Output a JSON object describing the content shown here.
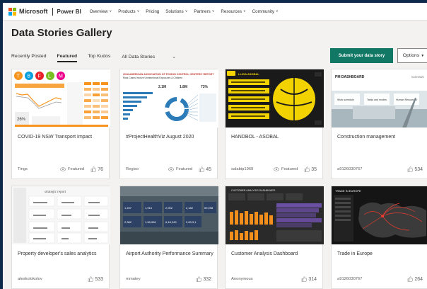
{
  "nav": {
    "brand": "Microsoft",
    "product": "Power BI",
    "items": [
      "Overview",
      "Products",
      "Pricing",
      "Solutions",
      "Partners",
      "Resources",
      "Community"
    ],
    "items_with_dropdown": [
      true,
      true,
      false,
      true,
      true,
      true,
      true
    ]
  },
  "page": {
    "title": "Data Stories Gallery"
  },
  "tabs": {
    "recent": "Recently Posted",
    "featured": "Featured",
    "kudos": "Top Kudos",
    "filter": "All Data Stories",
    "active": "Featured"
  },
  "actions": {
    "submit": "Submit your data story",
    "options": "Options"
  },
  "cards": [
    {
      "title": "COVID-19 NSW Transport Impact",
      "author": "Tings",
      "featured": "Featured",
      "likes": "76"
    },
    {
      "title": "#ProjectHealthViz August 2020",
      "author": "Regiso",
      "featured": "Featured",
      "likes": "45"
    },
    {
      "title": "HANDBOL - ASOBAL",
      "author": "salabip1969",
      "featured": "Featured",
      "likes": "35"
    },
    {
      "title": "Construction management",
      "author": "a9126030767",
      "featured": "",
      "likes": "534"
    },
    {
      "title": "Property developer's sales analytics",
      "author": "aleskolokolov",
      "featured": "",
      "likes": "533"
    },
    {
      "title": "Airport Authority Performance Summary",
      "author": "mmatey",
      "featured": "",
      "likes": "332"
    },
    {
      "title": "Customer Analysis Dashboard",
      "author": "Anonymous",
      "featured": "",
      "likes": "314"
    },
    {
      "title": "Trade in Europe",
      "author": "a9126030767",
      "featured": "",
      "likes": "264"
    }
  ],
  "thumb_text": {
    "health_line1": "2018 AMERICAN ASSOCIATION OF POISON CONTROL CENTERS' REPORT",
    "health_line2": "Most Cases Involve Unintentional Exposures & Children",
    "health_stat1": "2.1M",
    "health_stat2": "1.8M",
    "health_stat3": "73%",
    "handbol_brand": "LLIGA ASOBAL",
    "construction_title": "PM DASHBOARD",
    "construction_date": "01/07/2020",
    "construction_btn1": "Work schedule",
    "construction_btn2": "Tasks and modes",
    "construction_btn3": "Human Resources",
    "property_title": "strategic report",
    "airport_stat1": "1,497",
    "airport_stat2": "1,916",
    "airport_stat3": "2,902",
    "airport_stat4": "2,182",
    "airport_stat5": "59,098",
    "airport_stat6": "2,382",
    "airport_stat7": "1,98,906",
    "airport_stat8": "6,18,243",
    "airport_stat9": "2,83,3,1",
    "customer_title": "CUSTOMER ANALYSIS DASHBOARD",
    "trade_title": "TRADE IN EUROPE"
  },
  "colors": {
    "accent_green": "#117865",
    "ms_red": "#f25022",
    "ms_green": "#7fba00",
    "ms_blue": "#00a4ef",
    "ms_yellow": "#ffb900",
    "outer_bg": "#0e2a4a"
  }
}
